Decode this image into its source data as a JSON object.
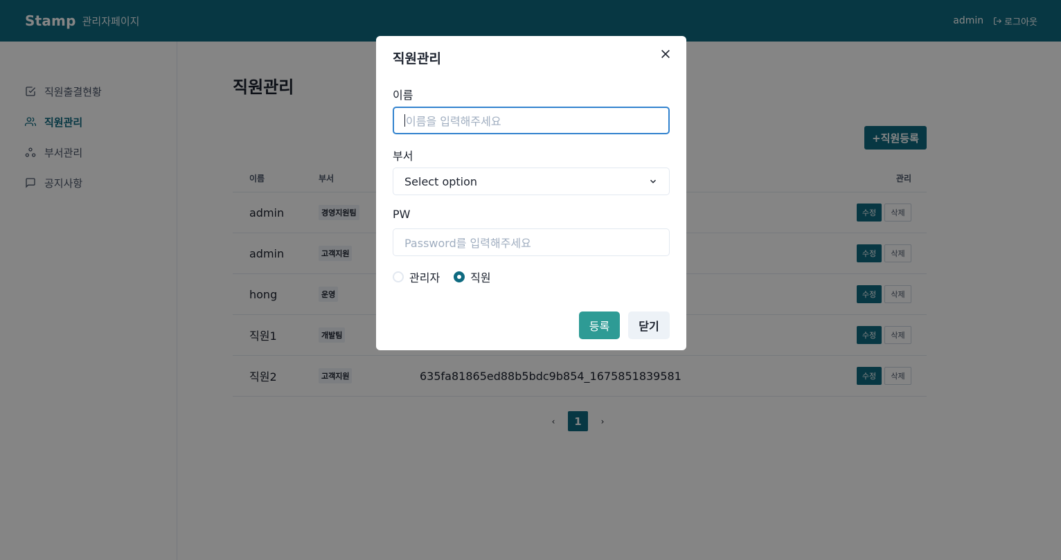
{
  "header": {
    "brand": "Stamp",
    "subtitle": "관리자페이지",
    "user": "admin",
    "logout_label": "로그아웃"
  },
  "sidebar": {
    "items": [
      {
        "label": "직원출결현황",
        "icon": "check-square-icon",
        "active": false
      },
      {
        "label": "직원관리",
        "icon": "users-icon",
        "active": true
      },
      {
        "label": "부서관리",
        "icon": "org-icon",
        "active": false
      },
      {
        "label": "공지사항",
        "icon": "message-square-icon",
        "active": false
      }
    ]
  },
  "main": {
    "title": "직원관리",
    "add_button": "+직원등록",
    "table": {
      "headers": [
        "이름",
        "부서",
        "",
        "관리"
      ],
      "rows": [
        {
          "name": "admin",
          "dept": "경영지원팀",
          "id": ""
        },
        {
          "name": "admin",
          "dept": "고객지원",
          "id": ""
        },
        {
          "name": "hong",
          "dept": "운영",
          "id": ""
        },
        {
          "name": "직원1",
          "dept": "개발팀",
          "id": ""
        },
        {
          "name": "직원2",
          "dept": "고객지원",
          "id": "635fa81865ed88b5bdc9b854_1675851839581"
        }
      ],
      "edit_label": "수정",
      "delete_label": "삭제"
    },
    "pagination": {
      "current": "1",
      "prev": "‹",
      "next": "›"
    }
  },
  "modal": {
    "title": "직원관리",
    "name_label": "이름",
    "name_placeholder": "이름을 입력해주세요",
    "dept_label": "부서",
    "dept_value": "Select option",
    "pw_label": "PW",
    "pw_placeholder": "Password를 입력해주세요",
    "radio_admin": "관리자",
    "radio_staff": "직원",
    "selected_role": "직원",
    "submit_label": "등록",
    "cancel_label": "닫기"
  },
  "colors": {
    "primary": "#0e6a80",
    "submit": "#2e9b95",
    "focus": "#3182ce"
  }
}
